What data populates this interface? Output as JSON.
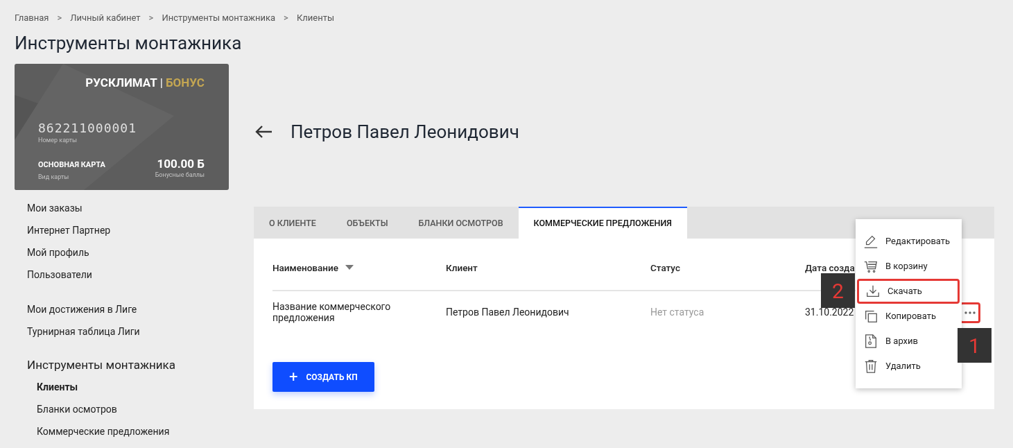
{
  "breadcrumbs": [
    "Главная",
    "Личный кабинет",
    "Инструменты монтажника",
    "Клиенты"
  ],
  "breadcrumb_separator": ">",
  "page_title": "Инструменты монтажника",
  "bonus_card": {
    "brand": "РУСКЛИМАТ",
    "brand_separator": "|",
    "program": "БОНУС",
    "number": "862211000001",
    "number_label": "Номер карты",
    "card_type": "ОСНОВНАЯ КАРТА",
    "card_type_label": "Вид карты",
    "balance": "100.00 Б",
    "balance_label": "Бонусные баллы"
  },
  "sidebar": {
    "groups": [
      {
        "items": [
          {
            "label": "Мои заказы"
          },
          {
            "label": "Интернет Партнер"
          },
          {
            "label": "Мой профиль"
          },
          {
            "label": "Пользователи"
          }
        ]
      },
      {
        "items": [
          {
            "label": "Мои достижения в Лиге"
          },
          {
            "label": "Турнирная таблица Лиги"
          }
        ]
      },
      {
        "heading": "Инструменты монтажника",
        "items": [
          {
            "label": "Клиенты",
            "selected": true
          },
          {
            "label": "Бланки осмотров",
            "selected": false
          },
          {
            "label": "Коммерческие предложения",
            "selected": false
          }
        ]
      }
    ]
  },
  "client_name": "Петров Павел Леонидович",
  "tabs": [
    {
      "label": "О КЛИЕНТЕ",
      "selected": false
    },
    {
      "label": "ОБЪЕКТЫ",
      "selected": false
    },
    {
      "label": "БЛАНКИ ОСМОТРОВ",
      "selected": false
    },
    {
      "label": "КОММЕРЧЕСКИЕ ПРЕДЛОЖЕНИЯ",
      "selected": true
    }
  ],
  "table": {
    "columns": [
      {
        "label": "Наименование",
        "sorted": true
      },
      {
        "label": "Клиент",
        "sorted": false
      },
      {
        "label": "Статус",
        "sorted": false
      },
      {
        "label": "Дата созда",
        "sorted": false
      }
    ],
    "rows": [
      {
        "name": "Название коммерческого предложения",
        "client": "Петров Павел Леонидович",
        "status": "Нет статуса",
        "date": "31.10.2022",
        "more_highlighted": true
      }
    ]
  },
  "create_button": {
    "icon": "+",
    "label": "СОЗДАТЬ КП"
  },
  "context_menu": [
    {
      "kind": "edit",
      "label": "Редактировать",
      "highlighted": false
    },
    {
      "kind": "cart",
      "label": "В корзину",
      "highlighted": false
    },
    {
      "kind": "download",
      "label": "Скачать",
      "highlighted": true
    },
    {
      "kind": "copy",
      "label": "Копировать",
      "highlighted": false
    },
    {
      "kind": "archive",
      "label": "В архив",
      "highlighted": false
    },
    {
      "kind": "delete",
      "label": "Удалить",
      "highlighted": false
    }
  ],
  "annotations": [
    {
      "label": "2"
    },
    {
      "label": "1"
    }
  ]
}
